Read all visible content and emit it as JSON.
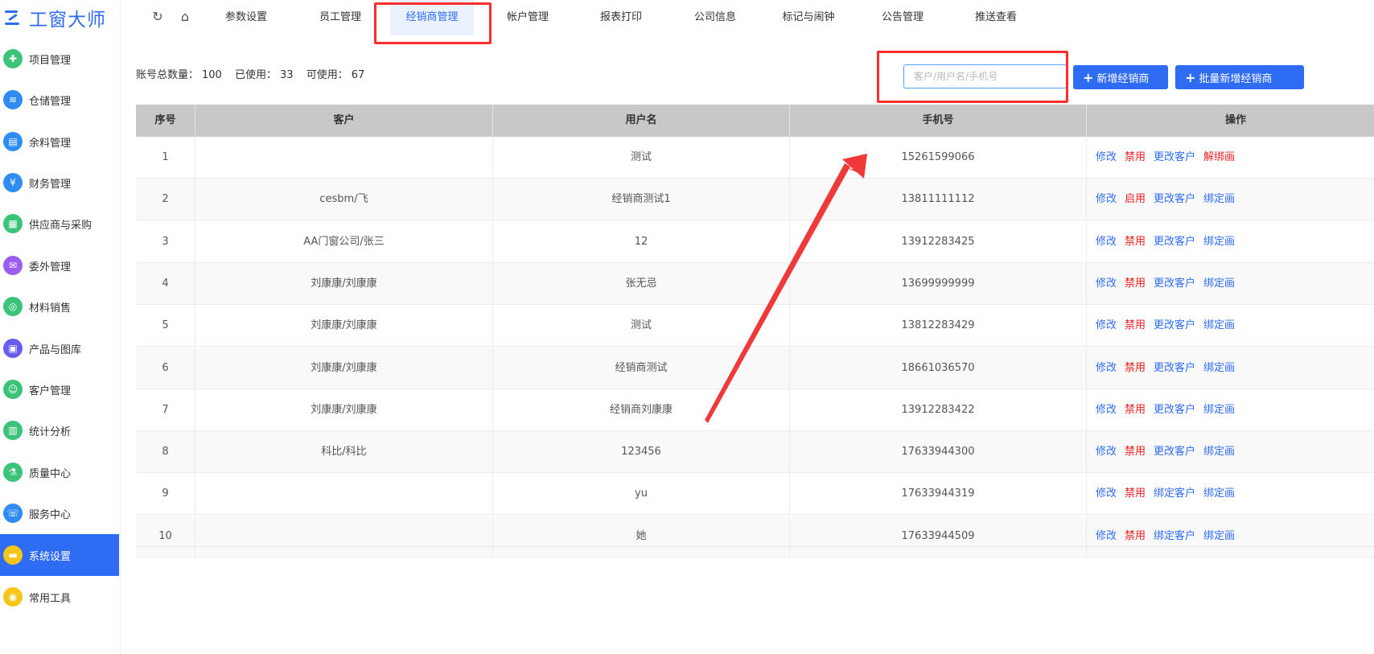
{
  "app": {
    "logo_text": "工窗大师"
  },
  "sidebar": {
    "items": [
      {
        "label": "项目管理",
        "icon": "project-icon",
        "color": "#3cc37a",
        "glyph": "✚"
      },
      {
        "label": "仓储管理",
        "icon": "warehouse-icon",
        "color": "#2f8cf4",
        "glyph": "≋"
      },
      {
        "label": "余料管理",
        "icon": "remnant-icon",
        "color": "#2f8cf4",
        "glyph": "▤"
      },
      {
        "label": "财务管理",
        "icon": "finance-icon",
        "color": "#2f8cf4",
        "glyph": "¥"
      },
      {
        "label": "供应商与采购",
        "icon": "supplier-icon",
        "color": "#3cc37a",
        "glyph": "▦"
      },
      {
        "label": "委外管理",
        "icon": "outsourcing-icon",
        "color": "#9b5cf0",
        "glyph": "✉"
      },
      {
        "label": "材料销售",
        "icon": "material-sales-icon",
        "color": "#3cc37a",
        "glyph": "◎"
      },
      {
        "label": "产品与图库",
        "icon": "product-gallery-icon",
        "color": "#6b5cf0",
        "glyph": "▣"
      },
      {
        "label": "客户管理",
        "icon": "customer-icon",
        "color": "#3cc37a",
        "glyph": "☺"
      },
      {
        "label": "统计分析",
        "icon": "statistics-icon",
        "color": "#3cc37a",
        "glyph": "▥"
      },
      {
        "label": "质量中心",
        "icon": "quality-icon",
        "color": "#3cc37a",
        "glyph": "⚗"
      },
      {
        "label": "服务中心",
        "icon": "service-icon",
        "color": "#2f8cf4",
        "glyph": "☏"
      },
      {
        "label": "系统设置",
        "icon": "settings-icon",
        "color": "#f5c518",
        "glyph": "▬"
      },
      {
        "label": "常用工具",
        "icon": "tools-icon",
        "color": "#f5c518",
        "glyph": "◉"
      }
    ]
  },
  "topnav": {
    "tabs": [
      "参数设置",
      "员工管理",
      "经销商管理",
      "帐户管理",
      "报表打印",
      "公司信息",
      "标记与闹钟",
      "公告管理",
      "推送查看"
    ]
  },
  "summary": {
    "total_label": "账号总数量：",
    "total": "100",
    "used_label": "已使用：",
    "used": "33",
    "available_label": "可使用：",
    "available": "67"
  },
  "search": {
    "placeholder": "客户/用户名/手机号"
  },
  "buttons": {
    "add": "新增经销商",
    "batch_add": "批量新增经销商"
  },
  "colors": {
    "accent": "#2f6cf4",
    "danger": "#f01d1d",
    "annotation": "#ff2e2e"
  },
  "table": {
    "headers": [
      "序号",
      "客户",
      "用户名",
      "手机号",
      "操作"
    ],
    "rows": [
      {
        "no": "1",
        "customer": "",
        "username": "测试",
        "phone": "15261599066",
        "ops": [
          "修改",
          "禁用",
          "更改客户",
          "解绑画"
        ]
      },
      {
        "no": "2",
        "customer": "cesbm/飞",
        "username": "经销商测试1",
        "phone": "13811111112",
        "ops": [
          "修改",
          "启用",
          "更改客户",
          "绑定画"
        ]
      },
      {
        "no": "3",
        "customer": "AA门窗公司/张三",
        "username": "12",
        "phone": "13912283425",
        "ops": [
          "修改",
          "禁用",
          "更改客户",
          "绑定画"
        ]
      },
      {
        "no": "4",
        "customer": "刘康康/刘康康",
        "username": "张无忌",
        "phone": "13699999999",
        "ops": [
          "修改",
          "禁用",
          "更改客户",
          "绑定画"
        ]
      },
      {
        "no": "5",
        "customer": "刘康康/刘康康",
        "username": "测试",
        "phone": "13812283429",
        "ops": [
          "修改",
          "禁用",
          "更改客户",
          "绑定画"
        ]
      },
      {
        "no": "6",
        "customer": "刘康康/刘康康",
        "username": "经销商测试",
        "phone": "18661036570",
        "ops": [
          "修改",
          "禁用",
          "更改客户",
          "绑定画"
        ]
      },
      {
        "no": "7",
        "customer": "刘康康/刘康康",
        "username": "经销商刘康康",
        "phone": "13912283422",
        "ops": [
          "修改",
          "禁用",
          "更改客户",
          "绑定画"
        ]
      },
      {
        "no": "8",
        "customer": "科比/科比",
        "username": "123456",
        "phone": "17633944300",
        "ops": [
          "修改",
          "禁用",
          "更改客户",
          "绑定画"
        ]
      },
      {
        "no": "9",
        "customer": "",
        "username": "yu",
        "phone": "17633944319",
        "ops": [
          "修改",
          "禁用",
          "绑定客户",
          "绑定画"
        ]
      },
      {
        "no": "10",
        "customer": "",
        "username": "她",
        "phone": "17633944509",
        "ops": [
          "修改",
          "禁用",
          "绑定客户",
          "绑定画"
        ]
      }
    ]
  }
}
